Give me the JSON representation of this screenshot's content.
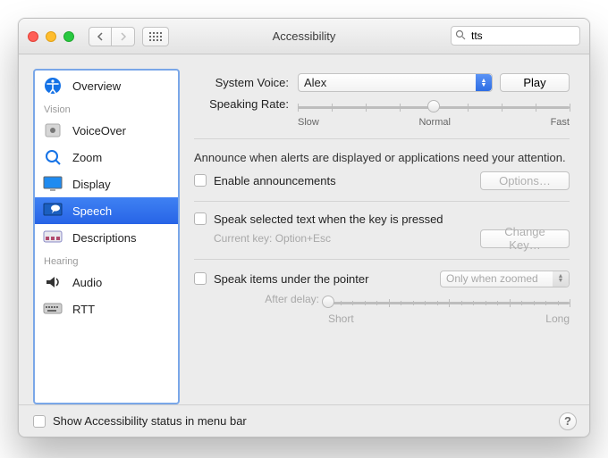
{
  "window": {
    "title": "Accessibility"
  },
  "search": {
    "value": "tts"
  },
  "sidebar": {
    "sections": [
      {
        "header": null,
        "items": [
          {
            "label": "Overview",
            "icon": "accessibility-icon",
            "selected": false
          }
        ]
      },
      {
        "header": "Vision",
        "items": [
          {
            "label": "VoiceOver",
            "icon": "voiceover-icon",
            "selected": false
          },
          {
            "label": "Zoom",
            "icon": "zoom-icon",
            "selected": false
          },
          {
            "label": "Display",
            "icon": "display-icon",
            "selected": false
          },
          {
            "label": "Speech",
            "icon": "speech-icon",
            "selected": true
          },
          {
            "label": "Descriptions",
            "icon": "descriptions-icon",
            "selected": false
          }
        ]
      },
      {
        "header": "Hearing",
        "items": [
          {
            "label": "Audio",
            "icon": "audio-icon",
            "selected": false
          },
          {
            "label": "RTT",
            "icon": "rtt-icon",
            "selected": false
          }
        ]
      }
    ]
  },
  "pane": {
    "system_voice_label": "System Voice:",
    "system_voice_value": "Alex",
    "play_button": "Play",
    "speaking_rate_label": "Speaking Rate:",
    "rate_marks": {
      "slow": "Slow",
      "normal": "Normal",
      "fast": "Fast"
    },
    "announce_desc": "Announce when alerts are displayed or applications need your attention.",
    "enable_announcements_label": "Enable announcements",
    "enable_announcements_checked": false,
    "options_button": "Options…",
    "speak_selected_label": "Speak selected text when the key is pressed",
    "speak_selected_checked": false,
    "current_key_label": "Current key: Option+Esc",
    "change_key_button": "Change Key…",
    "speak_pointer_label": "Speak items under the pointer",
    "speak_pointer_checked": false,
    "speak_pointer_mode": "Only when zoomed",
    "after_delay_label": "After delay:",
    "delay_marks": {
      "short": "Short",
      "long": "Long"
    }
  },
  "footer": {
    "menu_bar_label": "Show Accessibility status in menu bar",
    "menu_bar_checked": false
  }
}
